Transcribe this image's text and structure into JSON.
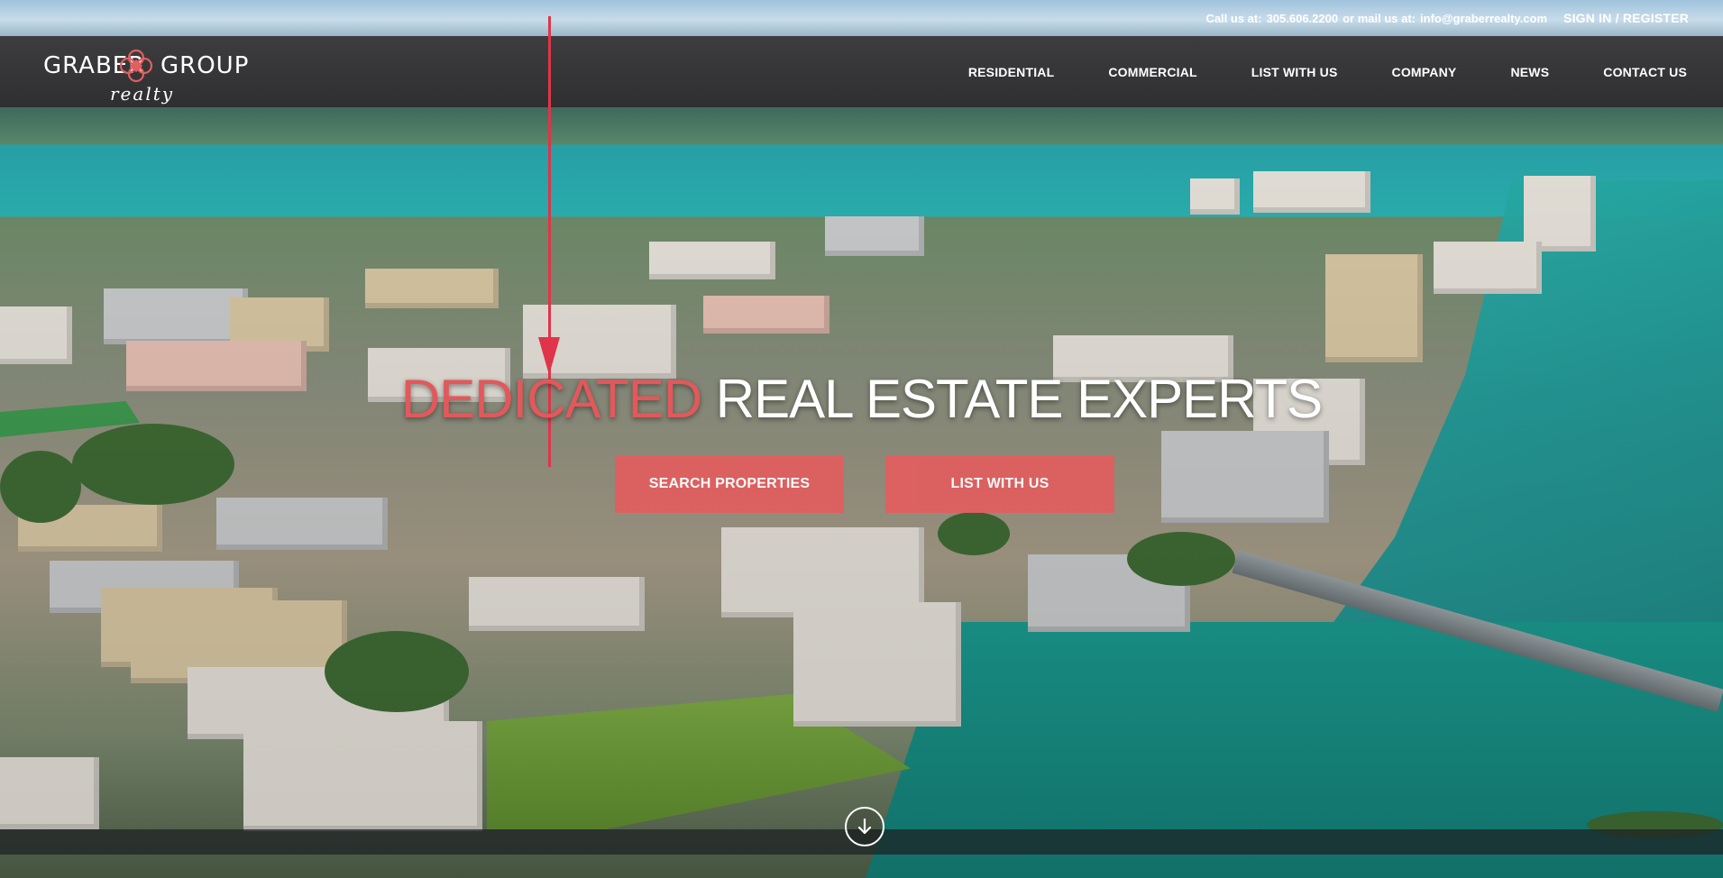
{
  "topbar": {
    "call_prefix": "Call us at:",
    "phone": "305.606.2200",
    "mail_prefix": "or mail us at:",
    "email": "info@graberrealty.com",
    "signin": "SIGN IN / REGISTER"
  },
  "logo": {
    "word_left": "GRABER",
    "word_right": "GROUP",
    "sub": "realty",
    "icon": "quatrefoil-logo-icon",
    "color": "#e05f5f"
  },
  "nav": {
    "items": [
      "RESIDENTIAL",
      "COMMERCIAL",
      "LIST WITH US",
      "COMPANY",
      "NEWS",
      "CONTACT US"
    ]
  },
  "hero": {
    "headline_accent": "DEDICATED",
    "headline_rest": " REAL ESTATE EXPERTS",
    "search_button": "SEARCH PROPERTIES",
    "list_button": "LIST WITH US",
    "scroll_icon": "arrow-down-circle-icon"
  },
  "colors": {
    "accent": "#e05f5f",
    "header_bg": "#333335",
    "marker": "#e0344a"
  }
}
